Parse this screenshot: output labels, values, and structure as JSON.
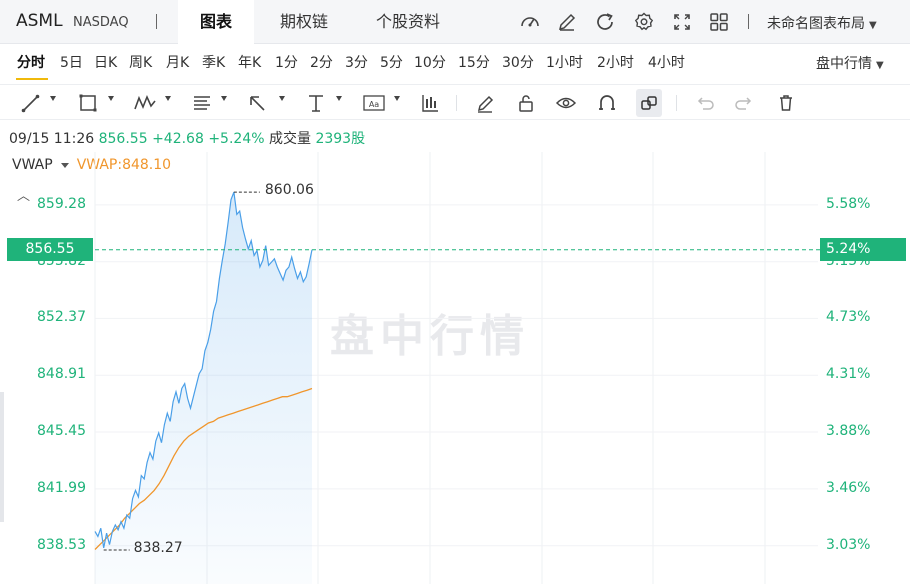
{
  "header": {
    "symbol": "ASML",
    "exchange": "NASDAQ",
    "tabs": [
      {
        "label": "图表",
        "active": true
      },
      {
        "label": "期权链",
        "active": false
      },
      {
        "label": "个股资料",
        "active": false
      }
    ],
    "icons": [
      "gauge-icon",
      "edit-icon",
      "refresh-icon",
      "settings-icon",
      "fullscreen-icon",
      "grid-layout-icon"
    ],
    "layout_label": "未命名图表布局"
  },
  "periods": {
    "items": [
      "分时",
      "5日",
      "日K",
      "周K",
      "月K",
      "季K",
      "年K",
      "1分",
      "2分",
      "3分",
      "5分",
      "10分",
      "15分",
      "30分",
      "1小时",
      "2小时",
      "4小时"
    ],
    "active": "分时",
    "session_mode": "盘中行情"
  },
  "quote": {
    "datetime": "09/15 11:26",
    "price": "856.55",
    "change": "+42.68",
    "change_pct": "+5.24%",
    "volume_label": "成交量",
    "volume_value": "2393股"
  },
  "indicator": {
    "name": "VWAP",
    "value_text": "VWAP:848.10"
  },
  "chart_data": {
    "type": "line",
    "y_ticks": [
      "859.28",
      "855.82",
      "852.37",
      "848.91",
      "845.45",
      "841.99",
      "838.53"
    ],
    "y_tick_values": [
      859.28,
      855.82,
      852.37,
      848.91,
      845.45,
      841.99,
      838.53
    ],
    "pct_ticks": [
      "5.58%",
      "5.15%",
      "4.73%",
      "4.31%",
      "3.88%",
      "3.46%",
      "3.03%"
    ],
    "ylim": [
      836.2,
      862.5
    ],
    "current_price_tag": "856.55",
    "current_pct_tag": "5.24%",
    "high_label": "860.06",
    "low_label": "838.27",
    "watermark": "盘中行情",
    "colors": {
      "price": "#4a9fe8",
      "vwap": "#f0962c",
      "up": "#1fb37a"
    },
    "series": [
      {
        "name": "price",
        "values": [
          839.4,
          839.1,
          839.6,
          838.4,
          839.3,
          838.6,
          839.4,
          839.8,
          839.5,
          840.0,
          839.6,
          840.4,
          840.2,
          841.4,
          841.9,
          841.5,
          842.8,
          842.6,
          843.6,
          844.2,
          843.8,
          844.9,
          845.4,
          844.8,
          845.9,
          846.6,
          846.1,
          847.3,
          847.9,
          847.2,
          848.1,
          848.4,
          847.5,
          846.9,
          847.6,
          848.3,
          849.0,
          849.3,
          850.4,
          850.9,
          851.7,
          852.8,
          853.4,
          854.8,
          855.9,
          856.9,
          858.2,
          859.6,
          860.06,
          858.7,
          858.9,
          857.9,
          857.2,
          856.6,
          857.1,
          856.2,
          856.5,
          855.5,
          855.9,
          856.8,
          855.6,
          855.8,
          856.0,
          855.5,
          855.1,
          854.7,
          855.3,
          855.5,
          856.1,
          855.4,
          854.8,
          855.2,
          854.6,
          854.9,
          855.7,
          856.55
        ]
      },
      {
        "name": "vwap",
        "values": [
          838.3,
          838.6,
          838.9,
          839.2,
          839.5,
          839.8,
          840.2,
          840.5,
          840.8,
          841.1,
          841.3,
          841.6,
          841.9,
          842.3,
          842.8,
          843.4,
          844.0,
          844.5,
          844.9,
          845.2,
          845.4,
          845.6,
          845.8,
          846.0,
          846.1,
          846.3,
          846.4,
          846.5,
          846.6,
          846.7,
          846.8,
          846.9,
          847.0,
          847.1,
          847.2,
          847.3,
          847.4,
          847.5,
          847.6,
          847.6,
          847.7,
          847.8,
          847.9,
          848.0,
          848.1
        ]
      }
    ]
  }
}
